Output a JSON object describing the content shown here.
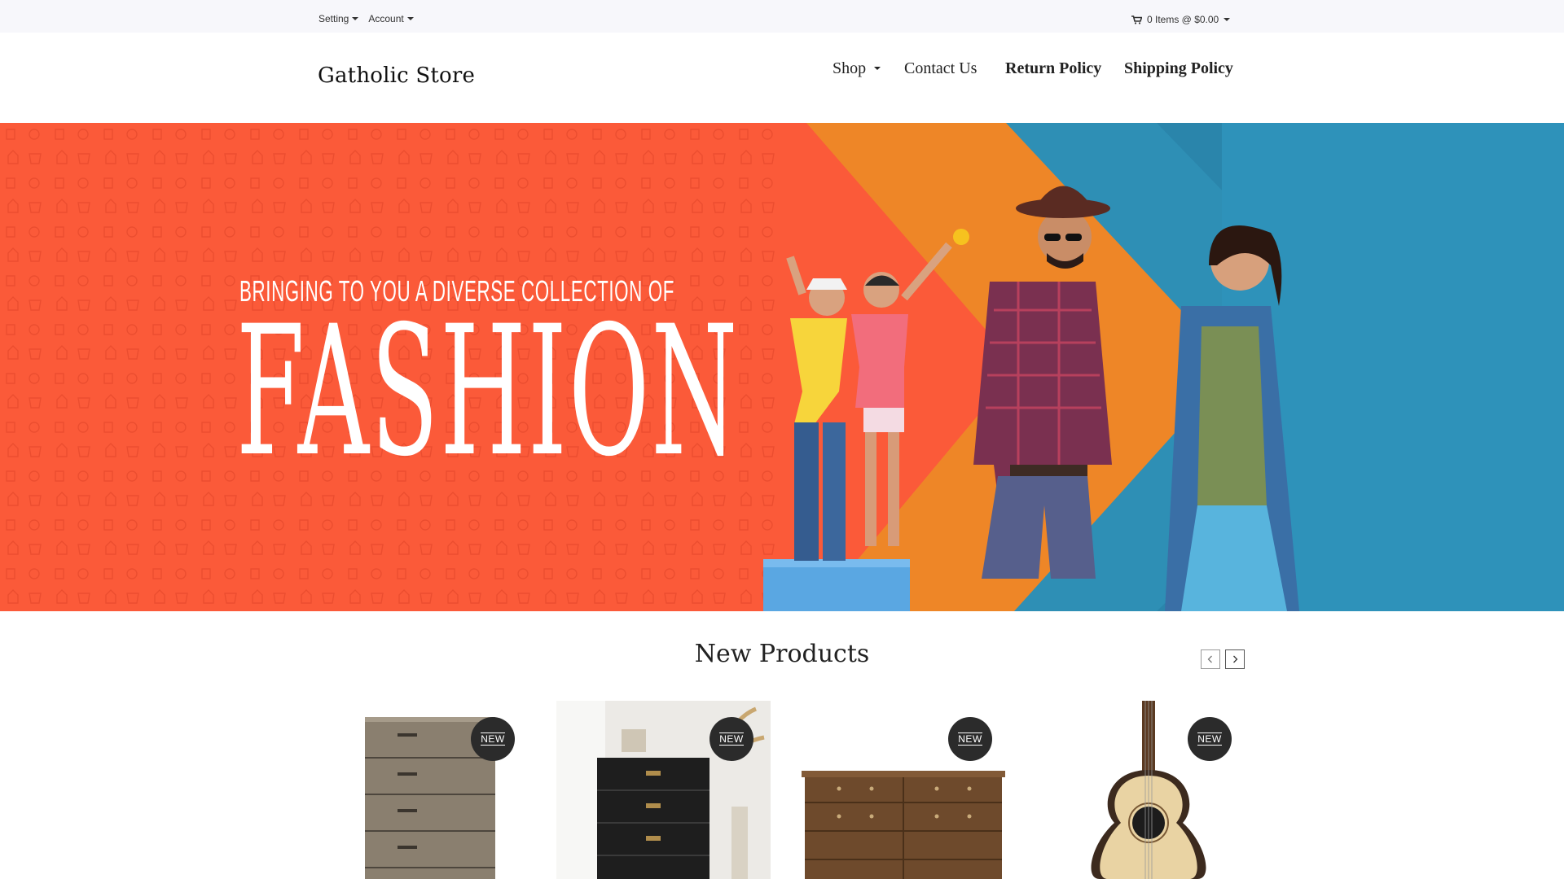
{
  "topbar": {
    "setting_label": "Setting",
    "account_label": "Account",
    "cart_label": "0 Items @ $0.00"
  },
  "header": {
    "logo": "Gatholic Store",
    "nav": {
      "shop": "Shop",
      "contact": "Contact Us",
      "return_policy": "Return Policy",
      "shipping_policy": "Shipping Policy"
    }
  },
  "hero": {
    "tagline": "BRINGING TO YOU A DIVERSE COLLECTION OF",
    "headline": "FASHION",
    "colors": {
      "orange_red": "#fb5a39",
      "orange": "#ee8627",
      "blue": "#2e8fb5",
      "dark_blue": "#2a7fa3"
    }
  },
  "new_products": {
    "title": "New Products",
    "prev_icon": "chevron-left-icon",
    "next_icon": "chevron-right-icon",
    "items": [
      {
        "name": "Chest of drawers",
        "badge": "NEW"
      },
      {
        "name": "Black dresser",
        "badge": "NEW"
      },
      {
        "name": "Wooden dresser",
        "badge": "NEW"
      },
      {
        "name": "Acoustic guitar",
        "badge": "NEW"
      }
    ]
  }
}
